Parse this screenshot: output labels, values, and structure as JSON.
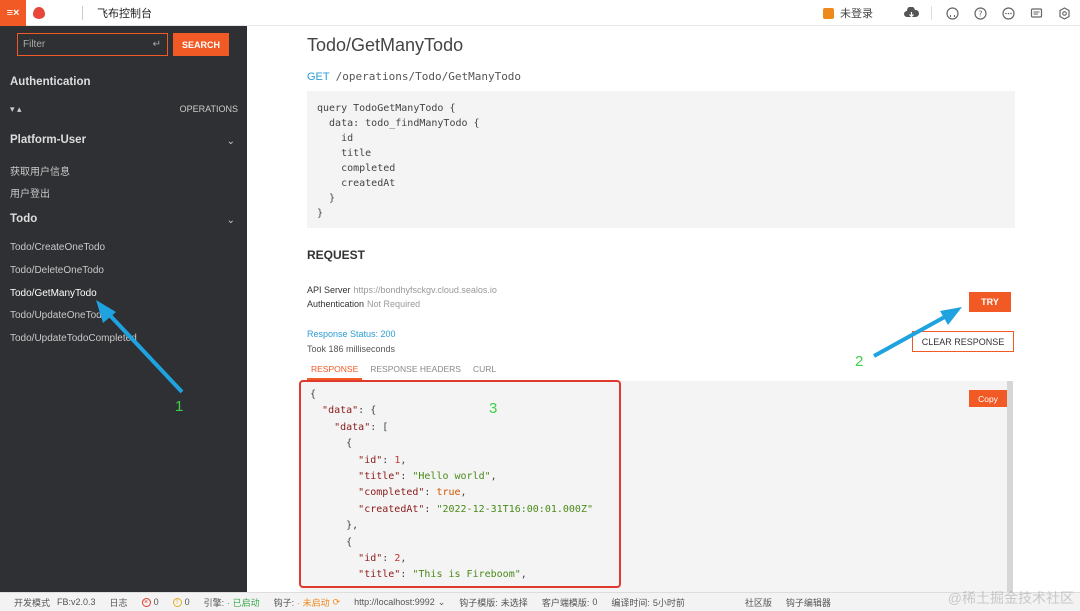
{
  "topbar": {
    "menu_icon": "menu-close-icon",
    "app_title": "飞布控制台",
    "login_label": "未登录",
    "icons": [
      "cloud-download-icon",
      "github-icon",
      "help-icon",
      "chat-icon",
      "message-icon",
      "settings-icon"
    ]
  },
  "sidebar": {
    "filter_placeholder": "Filter",
    "search_label": "SEARCH",
    "auth_title": "Authentication",
    "operations_label": "OPERATIONS",
    "groups": [
      {
        "title": "Platform-User",
        "items": [
          "获取用户信息",
          "用户登出"
        ]
      },
      {
        "title": "Todo",
        "items": [
          "Todo/CreateOneTodo",
          "Todo/DeleteOneTodo",
          "Todo/GetManyTodo",
          "Todo/UpdateOneTodo",
          "Todo/UpdateTodoCompleted"
        ]
      }
    ]
  },
  "main": {
    "title": "Todo/GetManyTodo",
    "method": "GET",
    "path": "/operations/Todo/GetManyTodo",
    "query": "query TodoGetManyTodo {\n  data: todo_findManyTodo {\n    id\n    title\n    completed\n    createdAt\n  }\n}",
    "request_title": "REQUEST",
    "api_server_label": "API Server",
    "api_server_value": "https://bondhyfsckgv.cloud.sealos.io",
    "auth_label": "Authentication",
    "auth_value": "Not Required",
    "try_label": "TRY",
    "response_status": "Response Status: 200",
    "took": "Took 186 milliseconds",
    "clear_label": "CLEAR RESPONSE",
    "tabs": [
      "RESPONSE",
      "RESPONSE HEADERS",
      "CURL"
    ],
    "copy_label": "Copy",
    "response_lines": [
      "{",
      "  \"data\": {",
      "    \"data\": [",
      "      {",
      "        \"id\": 1,",
      "        \"title\": \"Hello world\",",
      "        \"completed\": true,",
      "        \"createdAt\": \"2022-12-31T16:00:01.000Z\"",
      "      },",
      "      {",
      "        \"id\": 2,",
      "        \"title\": \"This is Fireboom\","
    ]
  },
  "statusbar": {
    "mode": "开发模式",
    "version": "FB:v2.0.3",
    "log": "日志",
    "errors": "0",
    "warnings": "0",
    "engine_label": "引擎:",
    "engine_status": "· 已启动",
    "hook_label": "钩子:",
    "hook_status": "· 未启动",
    "hook_url": "http://localhost:9992",
    "hook_template_label": "钩子模版:",
    "hook_template_value": "未选择",
    "client_template_label": "客户端模版:",
    "client_template_value": "0",
    "compile_label": "编译时间:",
    "compile_value": "5小时前",
    "community": "社区版",
    "hook_editor": "钩子编辑器"
  },
  "annotations": [
    "1",
    "2",
    "3"
  ],
  "watermark": "@稀土掘金技术社区",
  "colors": {
    "accent": "#f15a24",
    "sidebar_bg": "#2e3033",
    "link_blue": "#2a9dd4",
    "annotation_green": "#3fcf4a",
    "arrow_blue": "#1fa3e0",
    "annotation_red": "#e03a2c"
  }
}
